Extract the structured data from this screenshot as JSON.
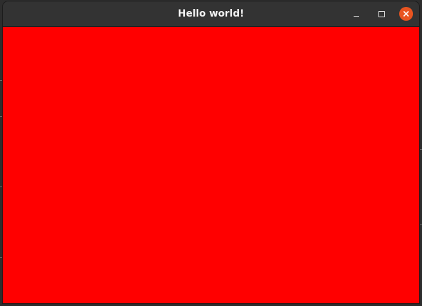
{
  "window": {
    "title": "Hello world!",
    "content_background": "#ff0000",
    "titlebar_background": "#333333"
  },
  "controls": {
    "minimize_icon": "minimize-icon",
    "maximize_icon": "maximize-icon",
    "close_icon": "close-icon",
    "close_color": "#e95420"
  }
}
